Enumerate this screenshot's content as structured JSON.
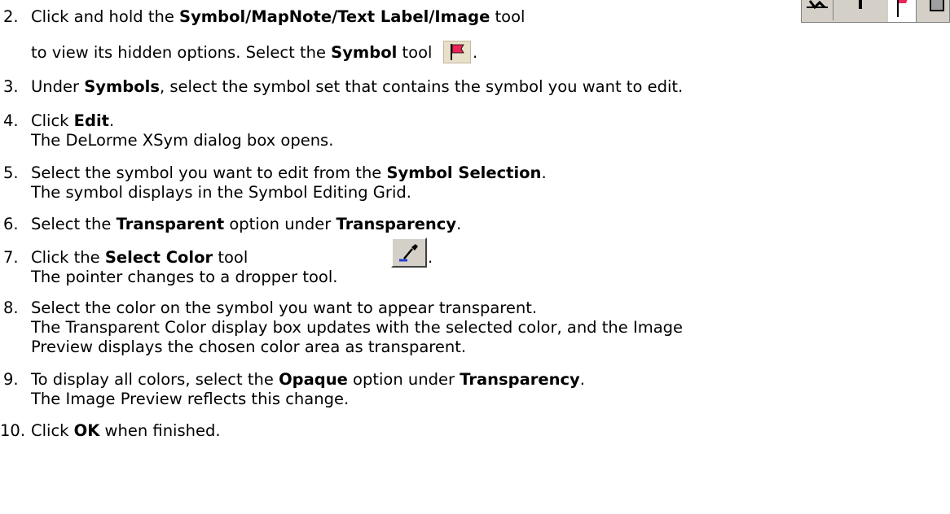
{
  "steps": [
    {
      "number": "2.",
      "line1": {
        "pre": "Click and hold the ",
        "bold": "Symbol/MapNote/Text Label/Image",
        "post": " tool"
      },
      "line2": {
        "pre": "to view its hidden options. Select the ",
        "bold": "Symbol",
        "post": " tool",
        "end": "."
      }
    },
    {
      "number": "3.",
      "line1": {
        "pre": "Under ",
        "bold": "Symbols",
        "post": ", select the symbol set that contains the symbol you want to edit."
      }
    },
    {
      "number": "4.",
      "line1": {
        "pre": "Click ",
        "bold": "Edit",
        "post": "."
      },
      "line2": {
        "text": "The DeLorme XSym dialog box opens."
      }
    },
    {
      "number": "5.",
      "line1": {
        "pre": "Select the symbol you want to edit from the ",
        "bold": "Symbol Selection",
        "post": "."
      },
      "line2": {
        "text": "The symbol displays in the Symbol Editing Grid."
      }
    },
    {
      "number": "6.",
      "line1": {
        "pre": "Select the ",
        "bold": "Transparent",
        "mid": " option under ",
        "bold2": "Transparency",
        "post": "."
      }
    },
    {
      "number": "7.",
      "line1": {
        "pre": "Click the ",
        "bold": "Select Color",
        "post": " tool",
        "end": "."
      },
      "line2": {
        "text": "The pointer changes to a dropper tool."
      }
    },
    {
      "number": "8.",
      "line1": {
        "text": "Select the color on the symbol you want to appear transparent."
      },
      "line2": {
        "text": "The Transparent Color display box updates with the selected color, and the Image"
      },
      "line3": {
        "text": "Preview displays the chosen color area as transparent."
      }
    },
    {
      "number": "9.",
      "line1": {
        "pre": "To display all colors, select the ",
        "bold": "Opaque",
        "mid": " option under ",
        "bold2": "Transparency",
        "post": "."
      },
      "line2": {
        "text": "The Image Preview reflects this change."
      }
    },
    {
      "number": "10.",
      "line1": {
        "pre": "Click ",
        "bold": "OK",
        "post": " when finished."
      }
    }
  ],
  "icons": {
    "toolbar": "symbol-mapnote-textlabel-image-toolbar",
    "symbol_tool": "red-flag-icon",
    "select_color_tool": "eyedropper-icon"
  },
  "colors": {
    "flag": "#e8265a",
    "dropper_blue": "#1f3fd0"
  }
}
